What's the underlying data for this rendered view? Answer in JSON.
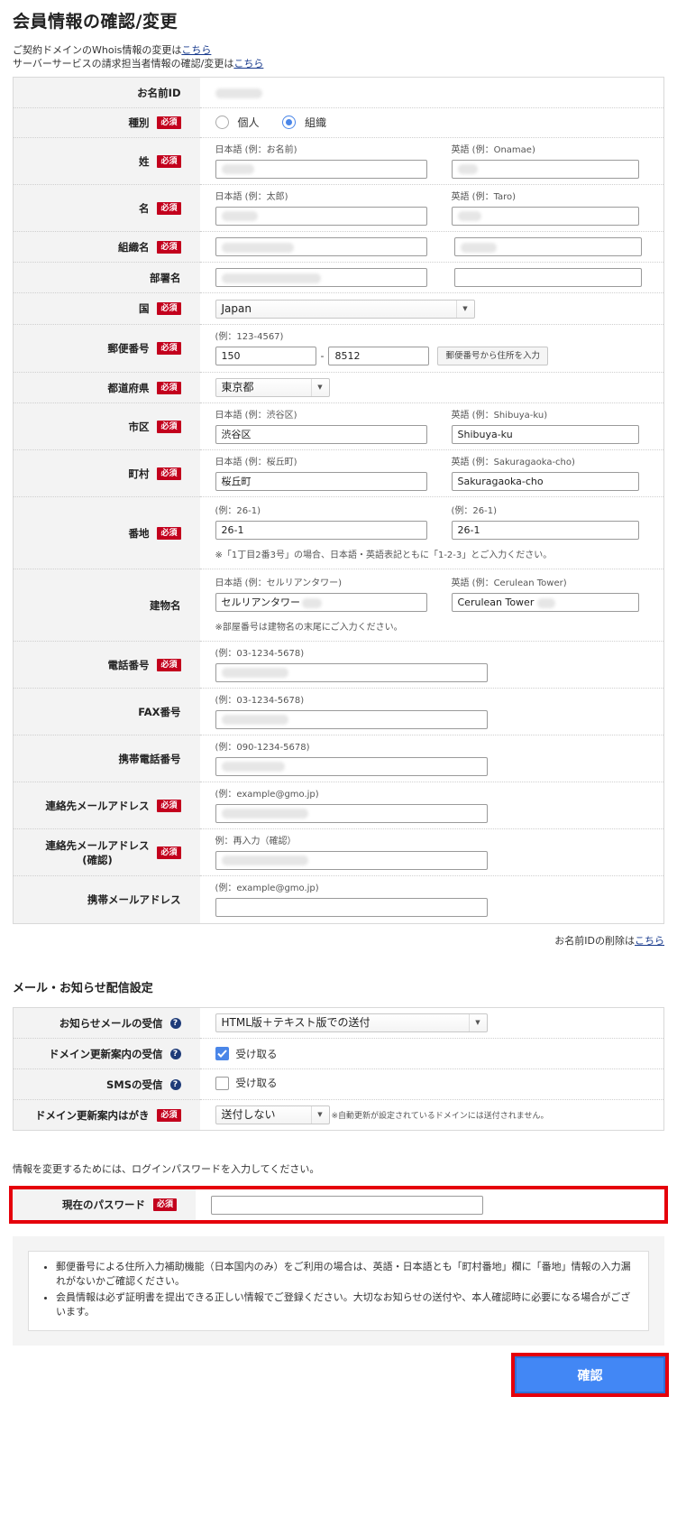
{
  "page": {
    "title": "会員情報の確認/変更",
    "link1_text": "ご契約ドメインのWhois情報の変更は",
    "link1_anchor": "こちら",
    "link2_text": "サーバーサービスの請求担当者情報の確認/変更は",
    "link2_anchor": "こちら"
  },
  "required_badge": "必須",
  "form": {
    "id_label": "お名前ID",
    "type": {
      "label": "種別",
      "options": [
        "個人",
        "組織"
      ],
      "selected": "組織"
    },
    "sei": {
      "label": "姓",
      "ja_hint": "日本語 (例：お名前)",
      "en_hint": "英語 (例：Onamae)"
    },
    "mei": {
      "label": "名",
      "ja_hint": "日本語 (例：太郎)",
      "en_hint": "英語 (例：Taro)"
    },
    "org": {
      "label": "組織名"
    },
    "dept": {
      "label": "部署名"
    },
    "country": {
      "label": "国",
      "value": "Japan"
    },
    "zip": {
      "label": "郵便番号",
      "hint": "(例：123-4567)",
      "value1": "150",
      "sep": "-",
      "value2": "8512",
      "button": "郵便番号から住所を入力"
    },
    "pref": {
      "label": "都道府県",
      "value": "東京都"
    },
    "city": {
      "label": "市区",
      "ja_hint": "日本語 (例：渋谷区)",
      "en_hint": "英語 (例：Shibuya-ku)",
      "ja_value": "渋谷区",
      "en_value": "Shibuya-ku"
    },
    "town": {
      "label": "町村",
      "ja_hint": "日本語 (例：桜丘町)",
      "en_hint": "英語 (例：Sakuragaoka-cho)",
      "ja_value": "桜丘町",
      "en_value": "Sakuragaoka-cho"
    },
    "banchi": {
      "label": "番地",
      "ja_hint": "(例：26-1)",
      "en_hint": "(例：26-1)",
      "ja_value": "26-1",
      "en_value": "26-1",
      "note": "※「1丁目2番3号」の場合、日本語・英語表記ともに「1-2-3」とご入力ください。"
    },
    "building": {
      "label": "建物名",
      "ja_hint": "日本語 (例：セルリアンタワー)",
      "en_hint": "英語 (例：Cerulean Tower)",
      "ja_value": "セルリアンタワー",
      "en_value": "Cerulean Tower",
      "note": "※部屋番号は建物名の末尾にご入力ください。"
    },
    "tel": {
      "label": "電話番号",
      "hint": "(例：03-1234-5678)"
    },
    "fax": {
      "label": "FAX番号",
      "hint": "(例：03-1234-5678)"
    },
    "mobile": {
      "label": "携帯電話番号",
      "hint": "(例：090-1234-5678)"
    },
    "email": {
      "label": "連絡先メールアドレス",
      "hint": "(例：example@gmo.jp)"
    },
    "email_confirm": {
      "label1": "連絡先メールアドレス",
      "label2": "(確認)",
      "hint": "例：再入力（確認）"
    },
    "mobile_email": {
      "label": "携帯メールアドレス",
      "hint": "(例：example@gmo.jp)"
    }
  },
  "delete_text": "お名前IDの削除は",
  "delete_anchor": "こちら",
  "mail": {
    "heading": "メール・お知らせ配信設定",
    "notice": {
      "label": "お知らせメールの受信",
      "value": "HTML版＋テキスト版での送付"
    },
    "renew": {
      "label": "ドメイン更新案内の受信",
      "checkbox": "受け取る",
      "checked": true
    },
    "sms": {
      "label": "SMSの受信",
      "checkbox": "受け取る",
      "checked": false
    },
    "postcard": {
      "label": "ドメイン更新案内はがき",
      "value": "送付しない",
      "note": "※自動更新が設定されているドメインには送付されません。"
    }
  },
  "password": {
    "intro": "情報を変更するためには、ログインパスワードを入力してください。",
    "label": "現在のパスワード"
  },
  "info": {
    "item1": "郵便番号による住所入力補助機能（日本国内のみ）をご利用の場合は、英語・日本語とも「町村番地」欄に「番地」情報の入力漏れがないかご確認ください。",
    "item2": "会員情報は必ず証明書を提出できる正しい情報でご登録ください。大切なお知らせの送付や、本人確認時に必要になる場合がございます。"
  },
  "submit_label": "確認"
}
